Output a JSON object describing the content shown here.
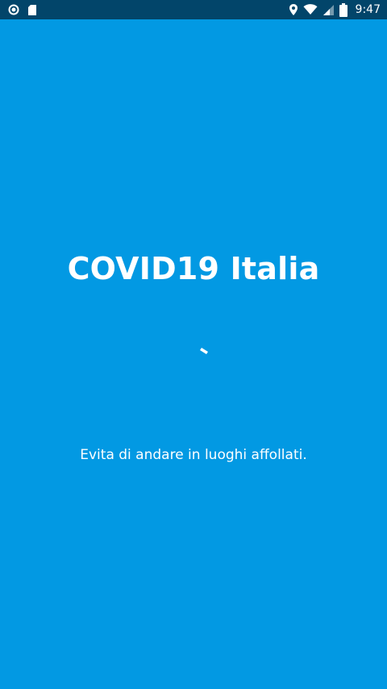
{
  "status_bar": {
    "time": "9:47",
    "icons": [
      "circle-notification-icon",
      "sd-card-icon",
      "location-icon",
      "wifi-icon",
      "cellular-signal-icon",
      "battery-icon"
    ],
    "background": "#02456a"
  },
  "splash": {
    "title": "COVID19 Italia",
    "tip": "Evita di andare in luoghi affollati.",
    "background": "#0299e3",
    "loading_indicator": "spinner-icon"
  }
}
